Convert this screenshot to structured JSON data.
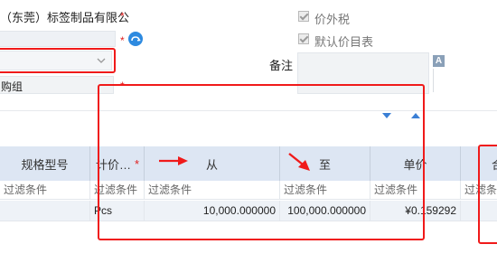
{
  "form": {
    "company_name": "（东莞）标签制品有限公",
    "required_mark": "*",
    "purchase_group_text": "购组",
    "checkbox_tax_excluded": "价外税",
    "checkbox_default_price_list": "默认价目表",
    "remark_label": "备注",
    "remark_icon_letter": "A"
  },
  "grid": {
    "headers": {
      "model": "规格型号",
      "unit": "计价…",
      "from": "从",
      "to": "至",
      "price": "单价",
      "next": "合"
    },
    "filter_placeholder": "过滤条件",
    "row": {
      "unit": "Pcs",
      "from": "10,000.000000",
      "to": "100,000.000000",
      "price": "¥0.159292"
    }
  },
  "colors": {
    "annotation_red": "#f01a1a",
    "header_bg": "#dde6f3",
    "row_bg": "#eef2f7",
    "accent_blue": "#3a7fd5"
  }
}
